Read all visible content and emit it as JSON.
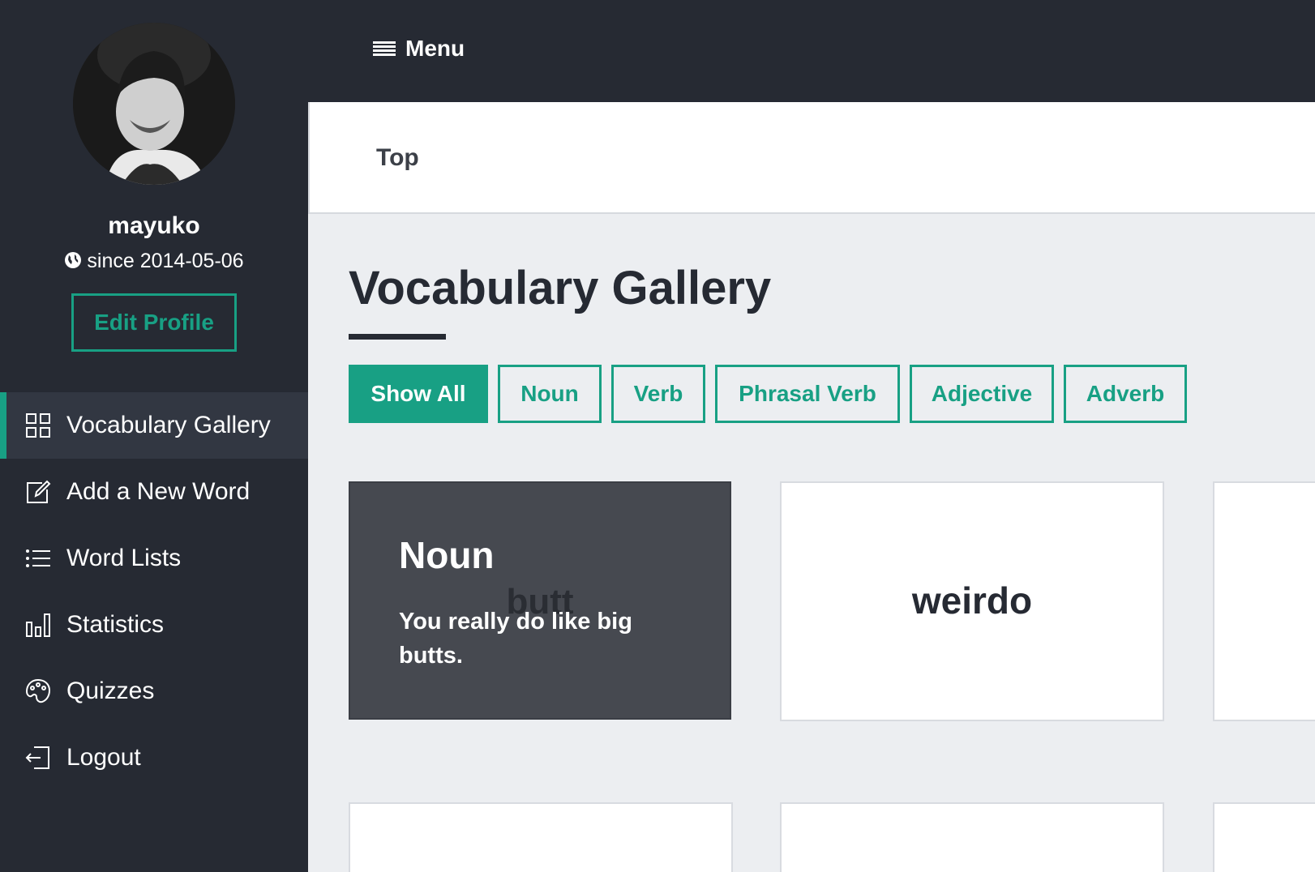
{
  "sidebar": {
    "username": "mayuko",
    "since": "since 2014-05-06",
    "edit_profile": "Edit Profile",
    "items": [
      {
        "label": "Vocabulary Gallery",
        "icon": "grid-icon",
        "active": true
      },
      {
        "label": "Add a New Word",
        "icon": "edit-icon"
      },
      {
        "label": "Word Lists",
        "icon": "list-icon"
      },
      {
        "label": "Statistics",
        "icon": "bar-chart-icon"
      },
      {
        "label": "Quizzes",
        "icon": "palette-icon"
      },
      {
        "label": "Logout",
        "icon": "logout-icon"
      }
    ]
  },
  "topbar": {
    "menu_label": "Menu"
  },
  "breadcrumb": {
    "current": "Top"
  },
  "main": {
    "title": "Vocabulary Gallery",
    "filters": [
      "Show All",
      "Noun",
      "Verb",
      "Phrasal Verb",
      "Adjective",
      "Adverb"
    ],
    "cards": [
      {
        "word": "butt",
        "part_of_speech": "Noun",
        "example": "You really do like big butts.",
        "flipped": true
      },
      {
        "word": "weirdo"
      }
    ]
  },
  "colors": {
    "accent": "#18a084",
    "sidebar_bg": "#262a33",
    "page_bg": "#eceef1"
  }
}
